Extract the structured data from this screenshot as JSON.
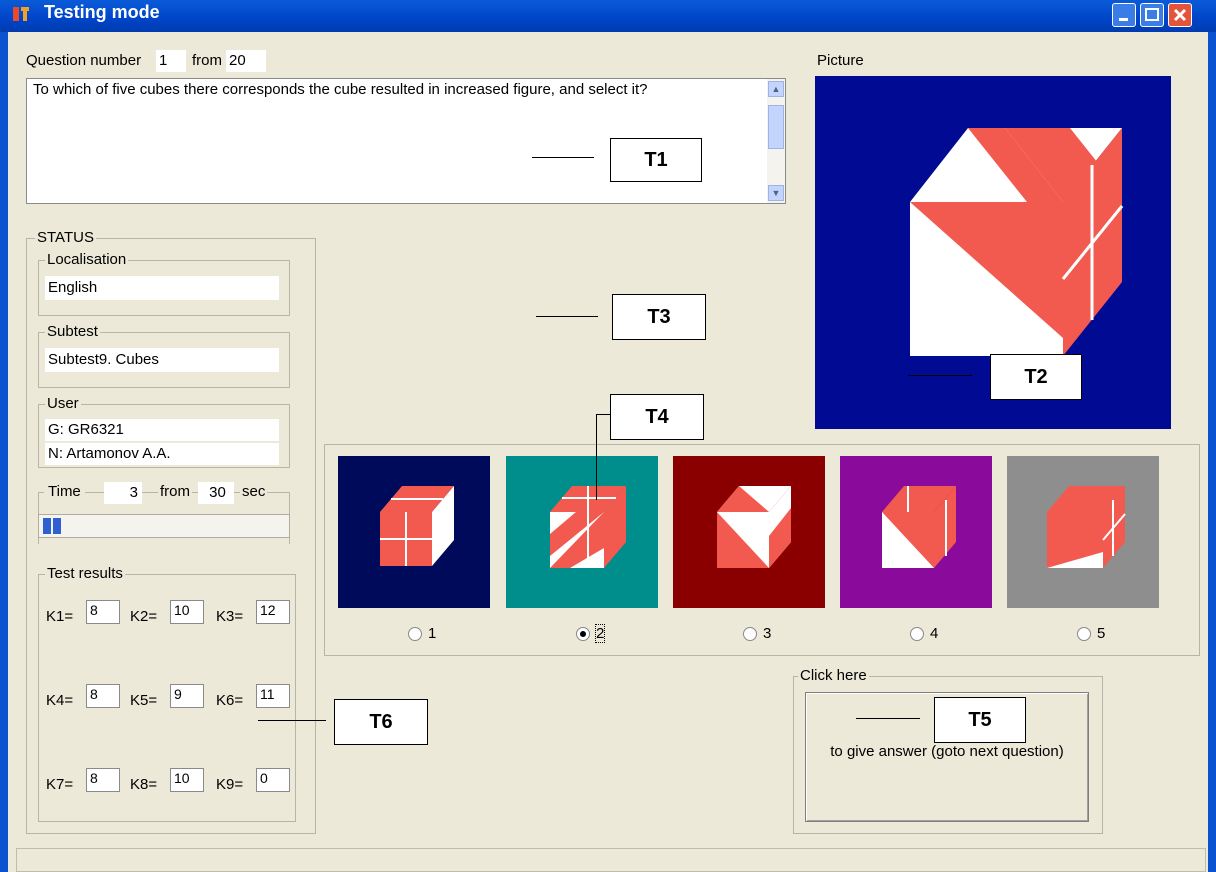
{
  "window": {
    "title": "Testing mode"
  },
  "question": {
    "number_label": "Question number",
    "number": "1",
    "from_label": "from",
    "total": "20",
    "text": "To which of five cubes there corresponds the cube resulted in increased figure, and select it?"
  },
  "picture": {
    "label": "Picture",
    "bg_color": "#000a92",
    "cube_color": "#f25a50"
  },
  "status": {
    "title": "STATUS",
    "localisation": {
      "label": "Localisation",
      "value": "English"
    },
    "subtest": {
      "label": "Subtest",
      "value": "Subtest9. Cubes"
    },
    "user": {
      "label": "User",
      "group": "G: GR6321",
      "name": "N: Artamonov A.A."
    },
    "time": {
      "label": "Time",
      "elapsed": "3",
      "from_label": "from",
      "total": "30",
      "unit": "sec",
      "progress": 0.1
    }
  },
  "results": {
    "title": "Test results",
    "items": [
      {
        "label": "K1=",
        "value": "8"
      },
      {
        "label": "K4=",
        "value": "8"
      },
      {
        "label": "K7=",
        "value": "8"
      },
      {
        "label": "K2=",
        "value": "10"
      },
      {
        "label": "K5=",
        "value": "9"
      },
      {
        "label": "K8=",
        "value": "10"
      },
      {
        "label": "K3=",
        "value": "12"
      },
      {
        "label": "K6=",
        "value": "11"
      },
      {
        "label": "K9=",
        "value": "0"
      }
    ]
  },
  "options": [
    {
      "label": "1",
      "bg": "#000a5a",
      "checked": false
    },
    {
      "label": "2",
      "bg": "#008e8c",
      "checked": true
    },
    {
      "label": "3",
      "bg": "#8a0000",
      "checked": false
    },
    {
      "label": "4",
      "bg": "#8a0a9c",
      "checked": false
    },
    {
      "label": "5",
      "bg": "#8e8e8e",
      "checked": false
    }
  ],
  "answer": {
    "group_label": "Click here",
    "button_text": "to give answer (goto next question)"
  },
  "annotations": {
    "t1": "T1",
    "t2": "T2",
    "t3": "T3",
    "t4": "T4",
    "t5": "T5",
    "t6": "T6"
  }
}
